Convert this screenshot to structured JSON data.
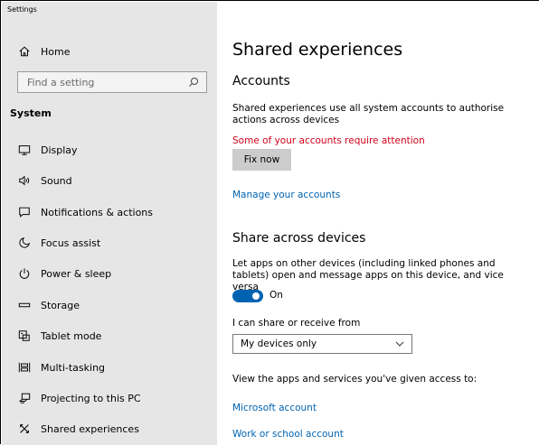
{
  "window": {
    "title": "Settings"
  },
  "sidebar": {
    "home_label": "Home",
    "search_placeholder": "Find a setting",
    "section_label": "System",
    "items": [
      {
        "label": "Display",
        "icon": "monitor-icon"
      },
      {
        "label": "Sound",
        "icon": "speaker-icon"
      },
      {
        "label": "Notifications & actions",
        "icon": "notifications-icon"
      },
      {
        "label": "Focus assist",
        "icon": "moon-icon"
      },
      {
        "label": "Power & sleep",
        "icon": "power-icon"
      },
      {
        "label": "Storage",
        "icon": "storage-icon"
      },
      {
        "label": "Tablet mode",
        "icon": "tablet-mode-icon"
      },
      {
        "label": "Multi-tasking",
        "icon": "multitasking-icon"
      },
      {
        "label": "Projecting to this PC",
        "icon": "projecting-icon"
      },
      {
        "label": "Shared experiences",
        "icon": "shared-experiences-icon"
      }
    ]
  },
  "main": {
    "title": "Shared experiences",
    "accounts": {
      "heading": "Accounts",
      "description": "Shared experiences use all system accounts to authorise actions across devices",
      "warning": "Some of your accounts require attention",
      "fix_button": "Fix now",
      "manage_link": "Manage your accounts"
    },
    "share": {
      "heading": "Share across devices",
      "description": "Let apps on other devices (including linked phones and tablets) open and message apps on this device, and vice versa",
      "toggle_state": "On",
      "share_from_label": "I can share or receive from",
      "share_from_value": "My devices only",
      "access_text": "View the apps and services you've given access to:",
      "links": [
        "Microsoft account",
        "Work or school account"
      ]
    }
  },
  "colors": {
    "accent": "#0063b1",
    "warning": "#d0021b",
    "sidebar_bg": "#e6e6e6",
    "button_bg": "#cccccc"
  }
}
